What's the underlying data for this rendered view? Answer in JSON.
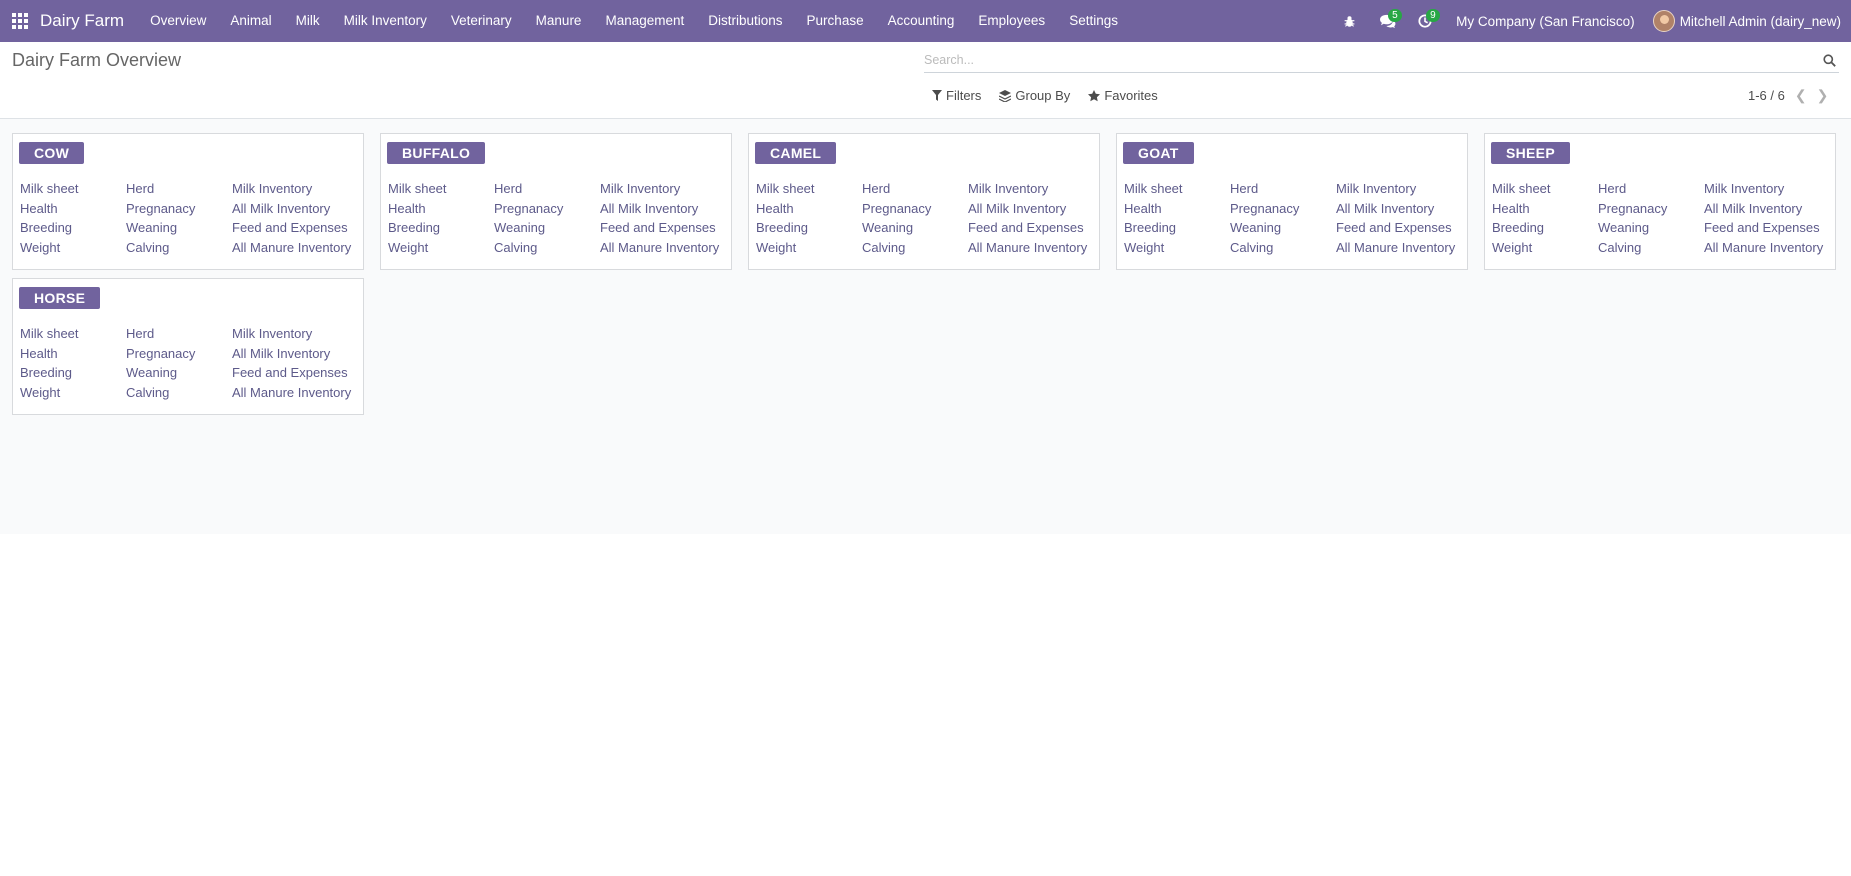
{
  "navbar": {
    "brand": "Dairy Farm",
    "menu": [
      "Overview",
      "Animal",
      "Milk",
      "Milk Inventory",
      "Veterinary",
      "Manure",
      "Management",
      "Distributions",
      "Purchase",
      "Accounting",
      "Employees",
      "Settings"
    ],
    "messages_count": "5",
    "activities_count": "9",
    "company": "My Company (San Francisco)",
    "user": "Mitchell Admin (dairy_new)",
    "color": "#71639e",
    "badge_color": "#28a745"
  },
  "control_panel": {
    "title": "Dairy Farm Overview",
    "search_placeholder": "Search...",
    "filters_label": "Filters",
    "groupby_label": "Group By",
    "favorites_label": "Favorites",
    "pager_value": "1-6 / 6"
  },
  "cards": [
    {
      "title": "COW",
      "links": [
        "Milk sheet",
        "Herd",
        "Milk Inventory",
        "Health",
        "Pregnanacy",
        "All Milk Inventory",
        "Breeding",
        "Weaning",
        "Feed and Expenses",
        "Weight",
        "Calving",
        "All Manure Inventory"
      ]
    },
    {
      "title": "BUFFALO",
      "links": [
        "Milk sheet",
        "Herd",
        "Milk Inventory",
        "Health",
        "Pregnanacy",
        "All Milk Inventory",
        "Breeding",
        "Weaning",
        "Feed and Expenses",
        "Weight",
        "Calving",
        "All Manure Inventory"
      ]
    },
    {
      "title": "CAMEL",
      "links": [
        "Milk sheet",
        "Herd",
        "Milk Inventory",
        "Health",
        "Pregnanacy",
        "All Milk Inventory",
        "Breeding",
        "Weaning",
        "Feed and Expenses",
        "Weight",
        "Calving",
        "All Manure Inventory"
      ]
    },
    {
      "title": "GOAT",
      "links": [
        "Milk sheet",
        "Herd",
        "Milk Inventory",
        "Health",
        "Pregnanacy",
        "All Milk Inventory",
        "Breeding",
        "Weaning",
        "Feed and Expenses",
        "Weight",
        "Calving",
        "All Manure Inventory"
      ]
    },
    {
      "title": "SHEEP",
      "links": [
        "Milk sheet",
        "Herd",
        "Milk Inventory",
        "Health",
        "Pregnanacy",
        "All Milk Inventory",
        "Breeding",
        "Weaning",
        "Feed and Expenses",
        "Weight",
        "Calving",
        "All Manure Inventory"
      ]
    },
    {
      "title": "HORSE",
      "links": [
        "Milk sheet",
        "Herd",
        "Milk Inventory",
        "Health",
        "Pregnanacy",
        "All Milk Inventory",
        "Breeding",
        "Weaning",
        "Feed and Expenses",
        "Weight",
        "Calving",
        "All Manure Inventory"
      ]
    }
  ]
}
